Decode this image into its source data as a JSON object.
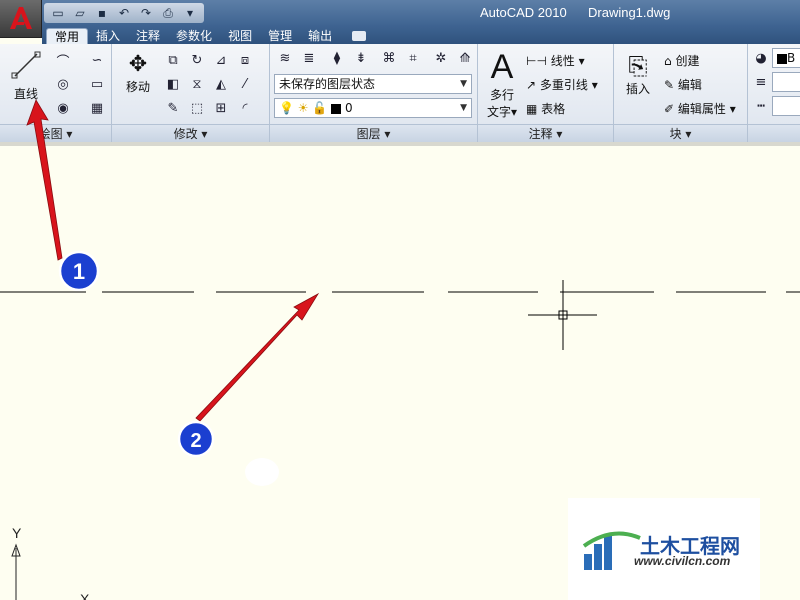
{
  "window": {
    "app_name": "AutoCAD 2010",
    "document": "Drawing1.dwg"
  },
  "tabs": [
    {
      "label": "常用",
      "active": true
    },
    {
      "label": "插入"
    },
    {
      "label": "注释"
    },
    {
      "label": "参数化"
    },
    {
      "label": "视图"
    },
    {
      "label": "管理"
    },
    {
      "label": "输出"
    }
  ],
  "ribbon": {
    "draw": {
      "panel_label": "绘图",
      "line_label": "直线"
    },
    "modify": {
      "panel_label": "修改",
      "move_label": "移动"
    },
    "layers": {
      "panel_label": "图层",
      "layer_state": "未保存的图层状态",
      "current_layer": "0"
    },
    "annotation": {
      "panel_label": "注释",
      "mtext_label_1": "多行",
      "mtext_label_2": "文字",
      "linear_label": "线性",
      "mleader_label": "多重引线",
      "table_label": "表格"
    },
    "block": {
      "panel_label": "块",
      "insert_label": "插入",
      "create_label": "创建",
      "edit_label": "编辑",
      "edit_attr_label": "编辑属性"
    },
    "properties": {
      "color_label": "B"
    }
  },
  "annotations": {
    "marker_1": "1",
    "marker_2": "2"
  },
  "ucs": {
    "y_label": "Y",
    "x_label": "X"
  },
  "watermark": {
    "brand": "土木工程网",
    "url": "www.civilcn.com"
  },
  "colors": {
    "canvas": "#fefef1",
    "titlebar": "#3e6391",
    "arrow_red": "#d8141c",
    "marker_blue": "#1b3fd0"
  }
}
